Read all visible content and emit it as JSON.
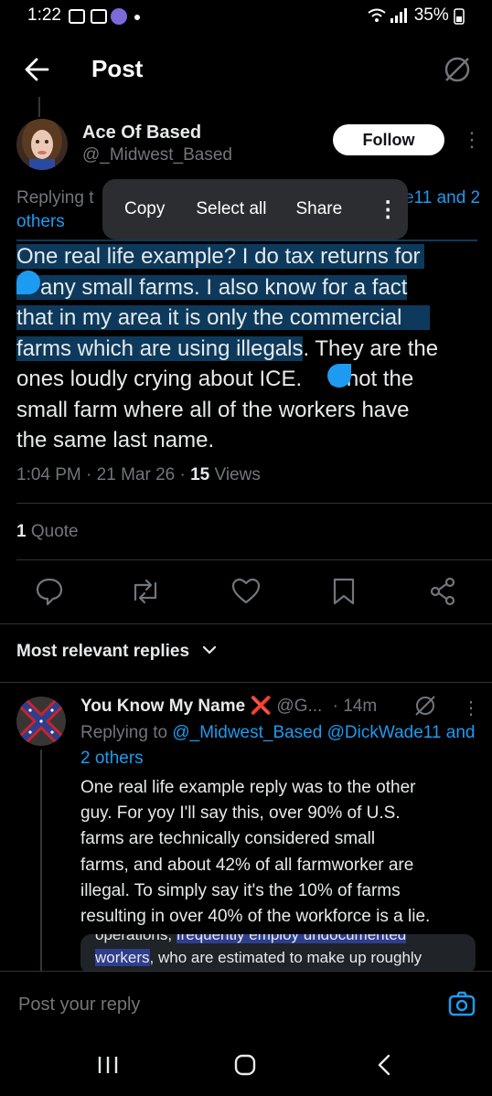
{
  "status_bar": {
    "time": "1:22",
    "battery": "35%"
  },
  "header": {
    "title": "Post"
  },
  "post": {
    "author_name": "Ace Of Based",
    "author_handle": "@_Midwest_Based",
    "follow_label": "Follow",
    "replying_prefix": "Replying t",
    "replying_tail": "e11 and 2",
    "replying_others": "others",
    "text_highlighted": [
      "One real life example? I do tax returns for",
      "any small farms. I also know for a fact",
      "that in my area it is only the commercial",
      "farms which are using illegals"
    ],
    "text_rest_line4": ". They are the",
    "text_line5_a": "ones loudly crying about ICE.",
    "text_line5_b": "s not the",
    "text_line6": "small farm where all of the workers have",
    "text_line7": "the same last name.",
    "time": "1:04 PM",
    "date": "21 Mar 26",
    "views_count": "15",
    "views_label": "Views",
    "quote_count": "1",
    "quote_label": "Quote"
  },
  "context_menu": {
    "copy": "Copy",
    "select_all": "Select all",
    "share": "Share"
  },
  "replies_filter": "Most relevant replies",
  "reply": {
    "name": "You Know My Name",
    "name_emoji": "❌",
    "handle": "@G...",
    "age": "14m",
    "replying_to": "Replying to",
    "mention1": "@_Midwest_Based",
    "mention2": "@DickWade11",
    "mention3": "and 2 others",
    "lines": [
      "One real life example reply was to the other",
      "guy. For yoy I'll say this, over 90% of U.S.",
      "farms are technically considered small",
      "farms, and about 42% of all farmworker are",
      "illegal. To simply say it's the 10% of farms",
      "resulting in over 40% of the workforce is a lie."
    ],
    "embed_line1_a": "operations,",
    "embed_line1_b": "frequently employ undocumented",
    "embed_line2_a": "workers",
    "embed_line2_b": ", who are estimated to make up roughly"
  },
  "composer": {
    "placeholder": "Post your reply"
  },
  "colors": {
    "accent": "#1d9bf0",
    "background": "#000000",
    "highlight": "#0d3a5c"
  }
}
